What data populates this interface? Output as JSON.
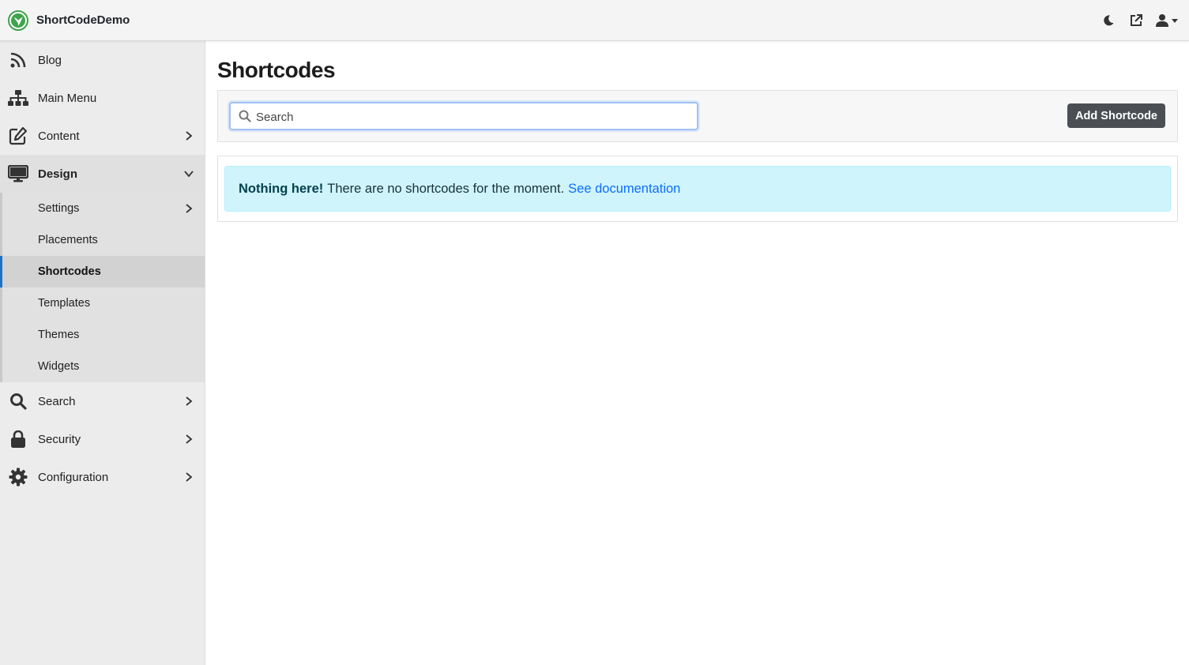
{
  "brand": {
    "name": "ShortCodeDemo",
    "logo_color": "#3fa34d"
  },
  "navbar": {
    "icons": [
      "moon-icon",
      "external-link-icon",
      "user-icon"
    ]
  },
  "sidebar": {
    "items": [
      {
        "label": "Blog",
        "icon": "rss-icon"
      },
      {
        "label": "Main Menu",
        "icon": "sitemap-icon"
      },
      {
        "label": "Content",
        "icon": "edit-icon"
      },
      {
        "label": "Design",
        "icon": "desktop-icon",
        "expanded": true
      },
      {
        "label": "Search",
        "icon": "search-icon"
      },
      {
        "label": "Security",
        "icon": "lock-icon"
      },
      {
        "label": "Configuration",
        "icon": "gear-icon"
      }
    ],
    "design_submenu": [
      {
        "label": "Settings"
      },
      {
        "label": "Placements"
      },
      {
        "label": "Shortcodes",
        "active": true
      },
      {
        "label": "Templates"
      },
      {
        "label": "Themes"
      },
      {
        "label": "Widgets"
      }
    ]
  },
  "main": {
    "title": "Shortcodes",
    "search": {
      "placeholder": "Search",
      "value": ""
    },
    "add_button": "Add Shortcode",
    "alert": {
      "strong": "Nothing here!",
      "text": "There are no shortcodes for the moment.",
      "link": "See documentation"
    }
  },
  "colors": {
    "accent": "#1a73c9",
    "alert_bg": "#cff4fc",
    "link": "#0d6efd",
    "button": "#4b4f54"
  }
}
